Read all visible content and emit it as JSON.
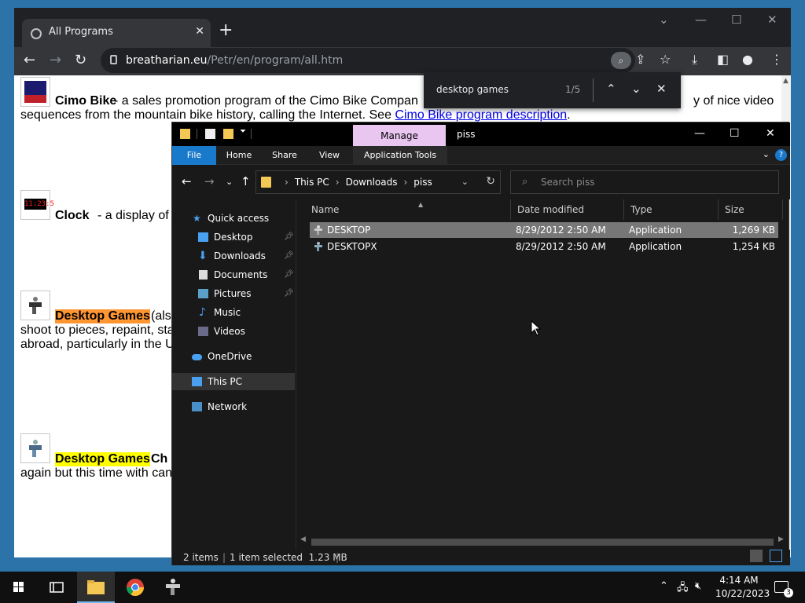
{
  "chrome": {
    "tab_title": "All Programs",
    "tab_close_icon": "✕",
    "new_tab_icon": "+",
    "url_host": "breatharian.eu",
    "url_path": "/Petr/en/program/all.htm"
  },
  "find_bar": {
    "query": "desktop games",
    "match_count": "1/5"
  },
  "page": {
    "entries": [
      {
        "title": "Cimo Bike",
        "text_line1": " - a sales promotion program of the Cimo Bike Compan",
        "text_line1_right": "y of nice video",
        "text_line2": "sequences from the mountain bike history, calling the Internet. See ",
        "link": "Cimo Bike program description",
        "link_suffix": "."
      },
      {
        "title": "Clock",
        "text_line1": " - a display of t"
      },
      {
        "title": "Desktop Games",
        "text_line1": " (als",
        "text_line2": "shoot to pieces, repaint, sta",
        "text_line3": "abroad, particularly in the U"
      },
      {
        "title": "Desktop Games",
        "title_suffix": " Ch",
        "text_line2": "again but this time with can"
      }
    ]
  },
  "explorer": {
    "window_title": "piss",
    "context_tab": "Manage",
    "ribbon_tabs": [
      "File",
      "Home",
      "Share",
      "View",
      "Application Tools"
    ],
    "breadcrumb": [
      "This PC",
      "Downloads",
      "piss"
    ],
    "search_placeholder": "Search piss",
    "nav": {
      "quick_access": "Quick access",
      "items": [
        "Desktop",
        "Downloads",
        "Documents",
        "Pictures",
        "Music",
        "Videos"
      ],
      "onedrive": "OneDrive",
      "this_pc": "This PC",
      "network": "Network"
    },
    "columns": [
      "Name",
      "Date modified",
      "Type",
      "Size"
    ],
    "files": [
      {
        "name": "DESKTOP",
        "date": "8/29/2012 2:50 AM",
        "type": "Application",
        "size": "1,269 KB",
        "selected": true
      },
      {
        "name": "DESKTOPX",
        "date": "8/29/2012 2:50 AM",
        "type": "Application",
        "size": "1,254 KB",
        "selected": false
      }
    ],
    "status": {
      "items": "2 items",
      "selected": "1 item selected  1.23 MB"
    }
  },
  "taskbar": {
    "time": "4:14 AM",
    "date": "10/22/2023",
    "notification_count": "3"
  },
  "colors": {
    "desktop_bg": "#2b73a8",
    "explorer_file_tab": "#1979ca",
    "manage_tab": "#e8c6f0",
    "highlight_active": "#ff9632",
    "highlight_match": "#ffff00"
  }
}
